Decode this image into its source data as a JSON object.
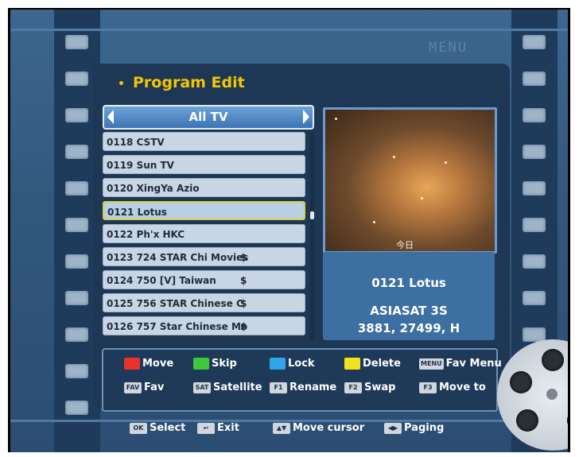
{
  "header": {
    "menu_label": "MENU",
    "title": "Program Edit"
  },
  "category": {
    "label": "All TV"
  },
  "channels": [
    {
      "label": "0118 CSTV",
      "symbol": ""
    },
    {
      "label": "0119 Sun TV",
      "symbol": ""
    },
    {
      "label": "0120 XingYa Azio",
      "symbol": ""
    },
    {
      "label": "0121 Lotus",
      "symbol": ""
    },
    {
      "label": "0122 Ph'x HKC",
      "symbol": ""
    },
    {
      "label": "0123 724 STAR Chi Movies",
      "symbol": "$"
    },
    {
      "label": "0124 750 [V] Taiwan",
      "symbol": "$"
    },
    {
      "label": "0125 756 STAR Chinese C",
      "symbol": "$"
    },
    {
      "label": "0126 757 Star Chinese Mo",
      "symbol": "$"
    }
  ],
  "selected_index": 3,
  "preview": {
    "caption": "今日"
  },
  "info": {
    "channel": "0121 Lotus",
    "satellite": "ASIASAT 3S",
    "transponder": "3881, 27499, H"
  },
  "keys": {
    "move": "Move",
    "skip": "Skip",
    "lock": "Lock",
    "delete": "Delete",
    "fav_menu": "Fav Menu",
    "fav": "Fav",
    "satellite": "Satellite",
    "rename": "Rename",
    "swap": "Swap",
    "move_to": "Move to",
    "menu_code": "MENU",
    "fav_code": "FAV",
    "sat_code": "SAT",
    "f1": "F1",
    "f2": "F2",
    "f3": "F3"
  },
  "footer": {
    "ok_code": "OK",
    "select": "Select",
    "exit_code": "↩",
    "exit": "Exit",
    "cursor_code": "▲▼",
    "move_cursor": "Move cursor",
    "page_code": "◀▶",
    "paging": "Paging"
  },
  "colors": {
    "red": "#e8322e",
    "green": "#3ec83a",
    "blue": "#2fa6e8",
    "yellow": "#f2e21c",
    "title": "#f3c600"
  },
  "icons": [
    "film-reel-icon",
    "arrow-left-icon",
    "arrow-right-icon"
  ]
}
